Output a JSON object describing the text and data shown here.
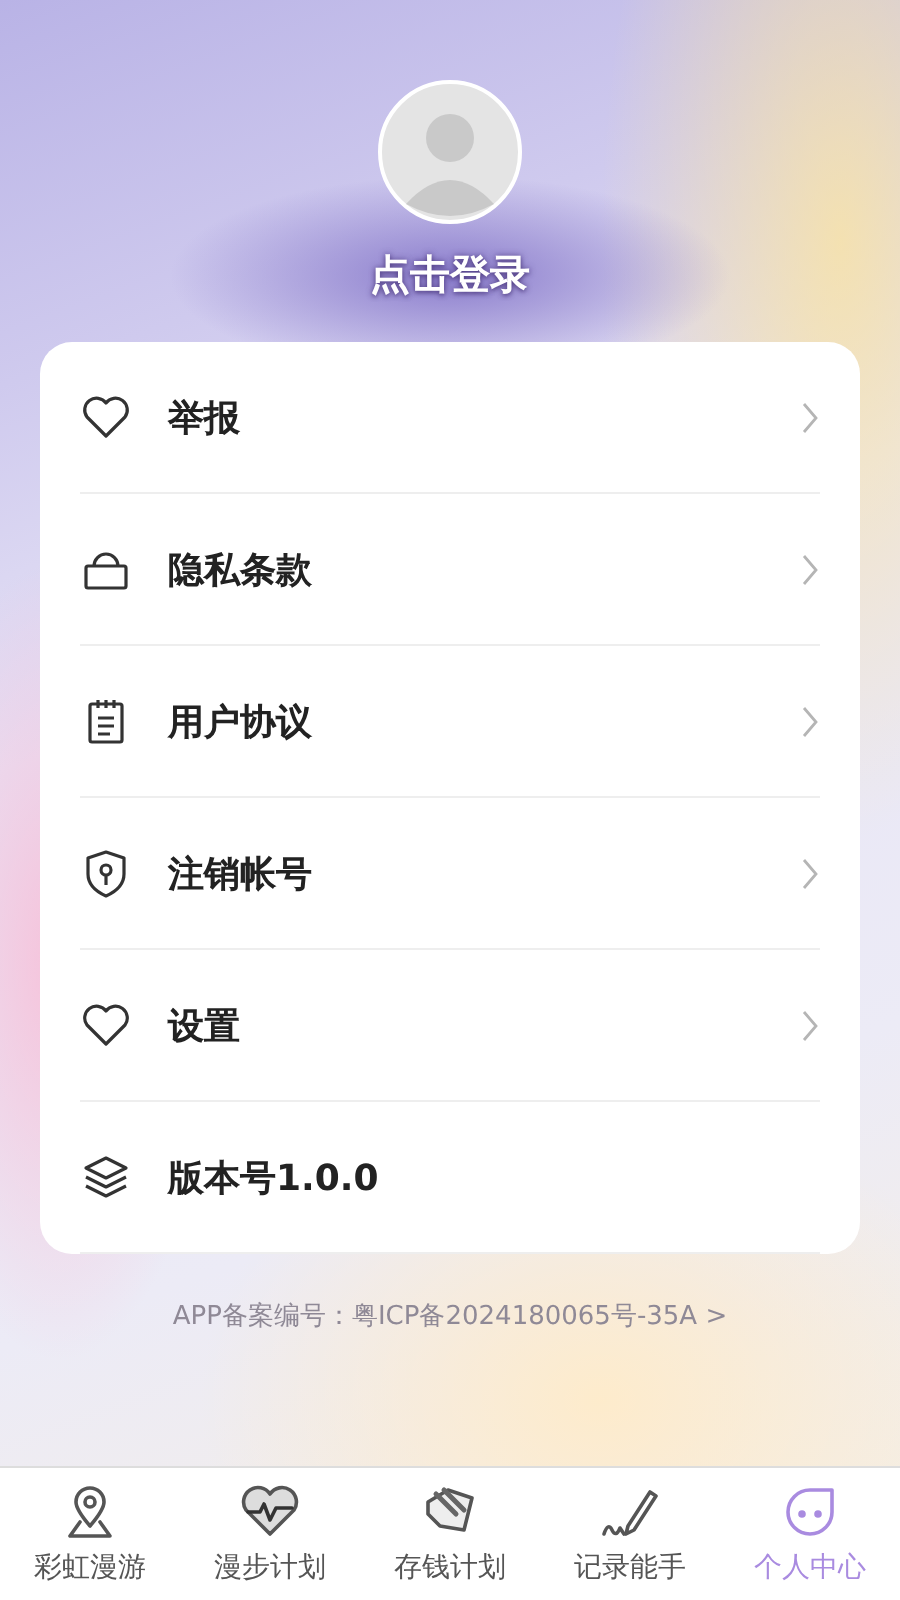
{
  "profile": {
    "login": "点击登录"
  },
  "menu": [
    {
      "kind": "link",
      "label": "举报"
    },
    {
      "kind": "link",
      "label": "隐私条款"
    },
    {
      "kind": "link",
      "label": "用户协议"
    },
    {
      "kind": "link",
      "label": "注销帐号"
    },
    {
      "kind": "link",
      "label": "设置"
    },
    {
      "kind": "info",
      "label": "版本号1.0.0"
    }
  ],
  "record_link": "APP备案编号：粤ICP备2024180065号-35A >",
  "tabs": [
    {
      "label": "彩虹漫游",
      "selected": false
    },
    {
      "label": "漫步计划",
      "selected": false
    },
    {
      "label": "存钱计划",
      "selected": false
    },
    {
      "label": "记录能手",
      "selected": false
    },
    {
      "label": "个人中心",
      "selected": true
    }
  ]
}
